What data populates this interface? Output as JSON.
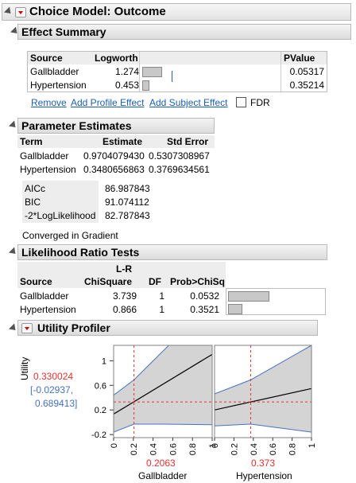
{
  "outline": {
    "title": "Choice Model: Outcome"
  },
  "effect_summary": {
    "title": "Effect Summary",
    "columns": [
      "Source",
      "Logworth",
      "",
      "PValue"
    ],
    "rows": [
      {
        "source": "Gallbladder",
        "logworth": "1.274",
        "pvalue": "0.05317",
        "bar_fraction": 0.5
      },
      {
        "source": "Hypertension",
        "logworth": "0.453",
        "pvalue": "0.35214",
        "bar_fraction": 0.18
      }
    ],
    "actions": [
      "Remove",
      "Add Profile Effect",
      "Add Subject Effect"
    ],
    "fdr_label": "FDR"
  },
  "parameter_estimates": {
    "title": "Parameter Estimates",
    "columns": [
      "Term",
      "Estimate",
      "Std Error"
    ],
    "rows": [
      {
        "term": "Gallbladder",
        "estimate": "0.9704079430",
        "std_error": "0.5307308967"
      },
      {
        "term": "Hypertension",
        "estimate": "0.3480656863",
        "std_error": "0.3769634561"
      }
    ],
    "fit_stats": [
      {
        "label": "AICc",
        "value": "86.987843"
      },
      {
        "label": "BIC",
        "value": "91.074112"
      },
      {
        "label": "-2*LogLikelihood",
        "value": "82.787843"
      }
    ],
    "converged": "Converged in Gradient"
  },
  "likelihood_ratio": {
    "title": "Likelihood Ratio Tests",
    "header_top": "L-R",
    "columns": [
      "Source",
      "ChiSquare",
      "DF",
      "Prob>ChiSq"
    ],
    "rows": [
      {
        "source": "Gallbladder",
        "chisq": "3.739",
        "df": "1",
        "prob": "0.0532",
        "bar_fraction": 0.5
      },
      {
        "source": "Hypertension",
        "chisq": "0.866",
        "df": "1",
        "prob": "0.3521",
        "bar_fraction": 0.17
      }
    ]
  },
  "utility_profiler": {
    "title": "Utility Profiler",
    "y_label": "Utility",
    "y_value": "0.330024",
    "y_ci": "[-0.02937,",
    "y_ci2": "0.689413]",
    "colors": {
      "current": "#e8312f",
      "ci": "#4472c4",
      "line": "#000000"
    }
  },
  "chart_data": {
    "type": "line",
    "y_ticks": [
      "1",
      "0.6",
      "0.2",
      "-0.2"
    ],
    "ylim": [
      -0.25,
      1.25
    ],
    "panels": [
      {
        "xlabel": "Gallbladder",
        "current_x": "0.2063",
        "current_x_value": 0.2063,
        "x_ticks": [
          "0",
          "0.2",
          "0.4",
          "0.6",
          "0.8",
          "1"
        ],
        "line": [
          [
            0,
            0.133
          ],
          [
            1,
            1.103
          ]
        ],
        "ci_upper": [
          [
            0,
            0.44
          ],
          [
            0.2063,
            0.689
          ],
          [
            1,
            1.95
          ]
        ],
        "ci_lower": [
          [
            0,
            -0.16
          ],
          [
            0.2063,
            -0.03
          ],
          [
            0.5,
            -0.03
          ],
          [
            1,
            -0.04
          ]
        ]
      },
      {
        "xlabel": "Hypertension",
        "current_x": "0.373",
        "current_x_value": 0.373,
        "x_ticks": [
          "0",
          "0.2",
          "0.4",
          "0.6",
          "0.8",
          "1"
        ],
        "line": [
          [
            0,
            0.2
          ],
          [
            1,
            0.548
          ]
        ],
        "ci_upper": [
          [
            0,
            0.46
          ],
          [
            0.373,
            0.689
          ],
          [
            1,
            1.25
          ]
        ],
        "ci_lower": [
          [
            0,
            -0.06
          ],
          [
            0.373,
            -0.03
          ],
          [
            1,
            -0.16
          ]
        ]
      }
    ]
  }
}
